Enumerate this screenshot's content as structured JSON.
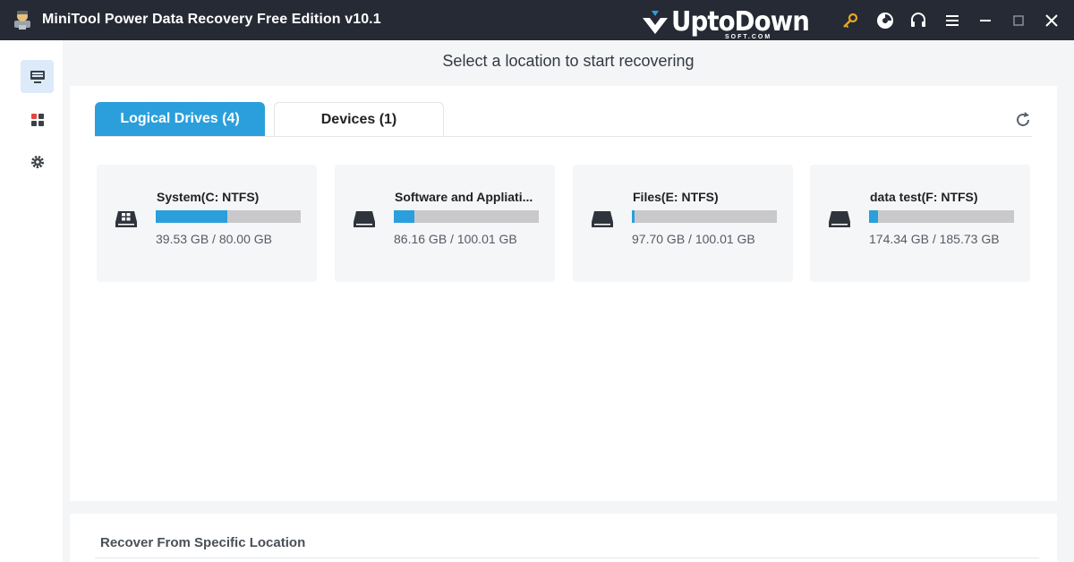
{
  "window": {
    "title": "MiniTool Power Data Recovery Free Edition v10.1",
    "watermark": "UptoDown",
    "watermark_sub": "SOFT.COM"
  },
  "titlebar_icons": [
    "key-icon",
    "disc-icon",
    "headset-icon",
    "menu-icon",
    "minimize-icon",
    "maximize-icon",
    "close-icon"
  ],
  "sidebar": {
    "items": [
      {
        "name": "this-pc",
        "icon": "computer-icon",
        "active": true
      },
      {
        "name": "apps",
        "icon": "apps-grid-icon",
        "active": false
      },
      {
        "name": "settings",
        "icon": "gear-icon",
        "active": false
      }
    ]
  },
  "main": {
    "heading": "Select a location to start recovering",
    "tabs": [
      {
        "label": "Logical Drives (4)",
        "active": true
      },
      {
        "label": "Devices (1)",
        "active": false
      }
    ],
    "drives": [
      {
        "name": "System(C: NTFS)",
        "size": "39.53 GB / 80.00 GB",
        "used_fraction": 0.494,
        "icon": "windows-drive-icon"
      },
      {
        "name": "Software and Appliati...",
        "size": "86.16 GB / 100.01 GB",
        "used_fraction": 0.14,
        "icon": "drive-icon"
      },
      {
        "name": "Files(E: NTFS)",
        "size": "97.70 GB / 100.01 GB",
        "used_fraction": 0.02,
        "icon": "drive-icon"
      },
      {
        "name": "data test(F: NTFS)",
        "size": "174.34 GB / 185.73 GB",
        "used_fraction": 0.06,
        "icon": "drive-icon"
      }
    ]
  },
  "bottom": {
    "title": "Recover From Specific Location"
  },
  "colors": {
    "titlebar_bg": "#252a34",
    "accent": "#2a9fdc",
    "key_icon": "#e8a823"
  }
}
